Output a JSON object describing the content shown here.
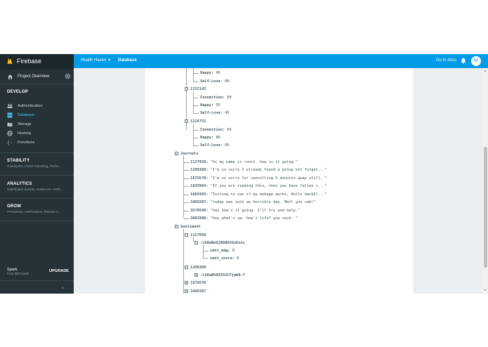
{
  "sidebar": {
    "brand": "Firebase",
    "project_overview": "Project Overview",
    "develop_title": "DEVELOP",
    "develop_items": [
      {
        "label": "Authentication",
        "icon": "people-icon"
      },
      {
        "label": "Database",
        "icon": "database-icon"
      },
      {
        "label": "Storage",
        "icon": "storage-icon"
      },
      {
        "label": "Hosting",
        "icon": "globe-icon"
      },
      {
        "label": "Functions",
        "icon": "functions-icon"
      }
    ],
    "stability_title": "STABILITY",
    "stability_sub": "Crashlytics, Crash Reporting, Perfor...",
    "analytics_title": "ANALYTICS",
    "analytics_sub": "Dashboard, Events, Audiences, Attrib...",
    "grow_title": "GROW",
    "grow_sub": "Predictions, Notifications, Remote C...",
    "plan_name": "Spark",
    "plan_price": "Free $0/month",
    "upgrade_label": "UPGRADE",
    "collapse_glyph": "‹"
  },
  "topbar": {
    "project": "Health Haven",
    "page": "Database",
    "docs": "Go to docs",
    "avatar_initial": "M"
  },
  "tree": {
    "n1": {
      "happy": "60",
      "self_love": "60"
    },
    "n1152142": {
      "id": "1152142",
      "connection": "60",
      "happy": "55",
      "self_love": "45"
    },
    "n1226755": {
      "id": "1226755",
      "connection": "65",
      "happy": "80",
      "self_love": "60"
    },
    "journals": {
      "label": "Journals",
      "entries": [
        {
          "id": "1127958",
          "text": "\"hi my name is ronit. how is it going.\""
        },
        {
          "id": "1208308",
          "text": "\"I'm so sorry I already found a group bit forgot...\""
        },
        {
          "id": "1676570",
          "text": "\"I'm so sorry for cancelling 5 minutes away still. \""
        },
        {
          "id": "1843904",
          "text": "\"If you are reading this, then you have fallen i...\""
        },
        {
          "id": "1868365",
          "text": "\"Testing to see if my webapp works, Hello hackIl...\""
        },
        {
          "id": "3466387",
          "text": "\"today was such an horrible day. Matt you cab!\""
        },
        {
          "id": "3570598",
          "text": "\"hey how's it going. I'll try and help.\""
        },
        {
          "id": "3602896",
          "text": "\"hey what's up, how's life? you suck. \""
        }
      ]
    },
    "sentiment": {
      "label": "Sentiment",
      "n1127958": "1127958",
      "push1": "-L6AwBoQjWSBUtUzEois",
      "sent_mag_key": "sent_mag",
      "sent_mag": "0",
      "sent_score_key": "sent_score",
      "sent_score": "0",
      "n1208308": "1208308",
      "push2": "-L6AwBh9ZXSVlFjmb9-7",
      "n1676570": "1676570",
      "n3466387": "3466387"
    },
    "labels": {
      "happy": "Happy:",
      "self_love": "Self-Love:",
      "connection": "Connection:"
    }
  },
  "colors": {
    "sidebar_bg": "#263238",
    "topbar_bg": "#039be5",
    "active_nav": "#4fc3f7"
  }
}
